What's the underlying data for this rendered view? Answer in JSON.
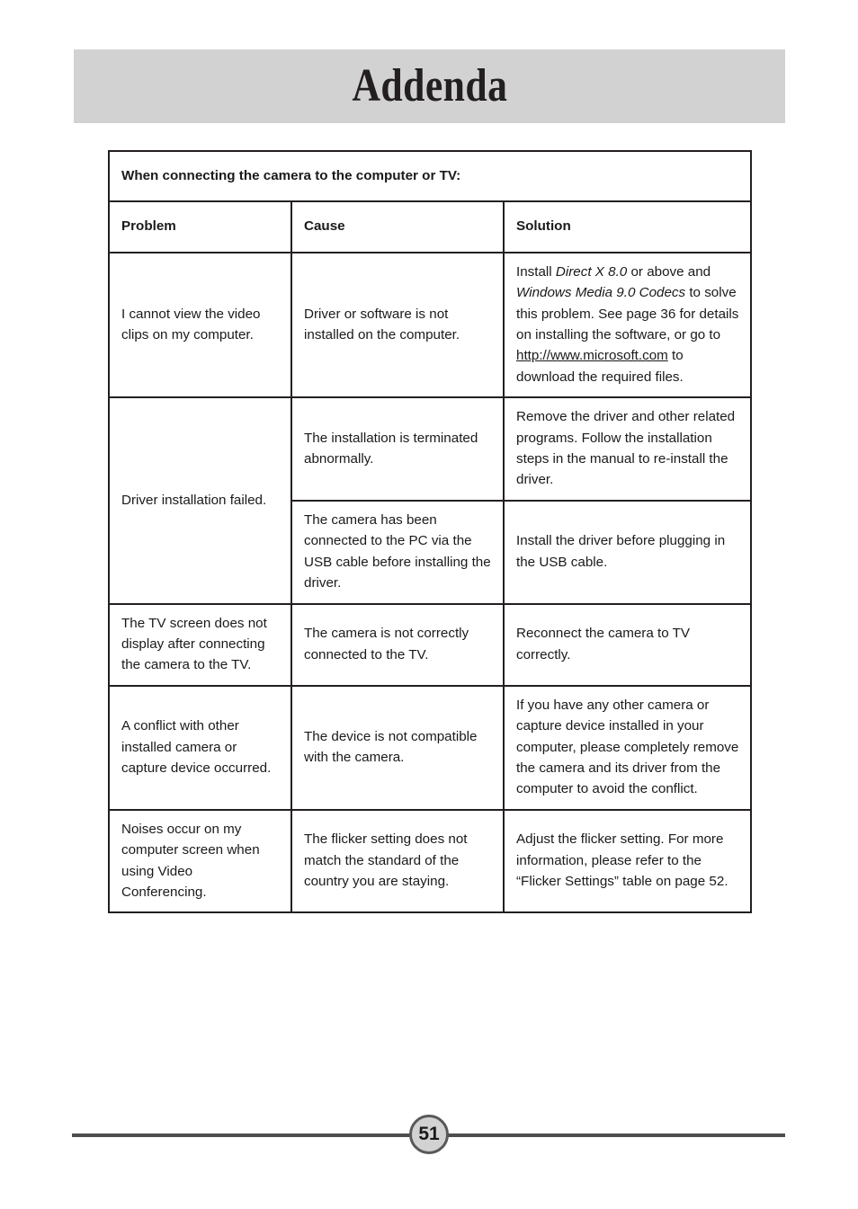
{
  "page": {
    "chapter_title": "Addenda",
    "page_number": "51"
  },
  "table": {
    "section_title": "When connecting the camera to the computer or TV:",
    "headers": {
      "problem": "Problem",
      "cause": "Cause",
      "solution": "Solution"
    },
    "rows": [
      {
        "problem": "I cannot view the video clips on my computer.",
        "cause": "Driver or software is not installed on the computer.",
        "solution_parts": {
          "p1": "Install ",
          "i1": "Direct X 8.0",
          "p2": " or above and ",
          "i2": "Windows Media 9.0 Codecs",
          "p3": " to solve this problem. See page 36 for details on installing the software, or go to ",
          "url": "http://www.microsoft.com",
          "p4": " to download the required files."
        },
        "solution_plain": "Install Direct X 8.0 or above and Windows Media 9.0 Codecs to solve this problem. See page 36 for details on installing the software, or go to http://www.microsoft.com to download the required files."
      },
      {
        "problem": "Driver installation failed.",
        "sub_rows": [
          {
            "cause": "The installation is terminated abnormally.",
            "solution": "Remove the driver and other related programs. Follow the installation steps in the manual to re-install the driver."
          },
          {
            "cause": "The camera has been connected to the PC via the USB cable before installing the driver.",
            "solution": "Install the driver before plugging in the USB cable."
          }
        ]
      },
      {
        "problem": "The TV screen does not display after connecting the camera to the TV.",
        "cause": "The camera is not correctly connected to the TV.",
        "solution": "Reconnect the camera to TV correctly."
      },
      {
        "problem": "A conflict with other installed camera or capture device occurred.",
        "cause": "The device is not compatible with the camera.",
        "solution": "If you have any other camera or capture device installed in your computer, please completely remove the camera and its driver from the computer to avoid the conflict."
      },
      {
        "problem": "Noises occur on my computer screen when using Video Conferencing.",
        "cause": "The flicker setting does not match the standard of the country you are staying.",
        "solution": "Adjust the flicker setting. For more information, please refer to the “Flicker Settings” table on page 52."
      }
    ]
  },
  "colors": {
    "band_gray": "#d2d2d2",
    "rule_gray": "#4d4d4d",
    "text_black": "#1a1a1a",
    "border_black": "#231f20"
  }
}
